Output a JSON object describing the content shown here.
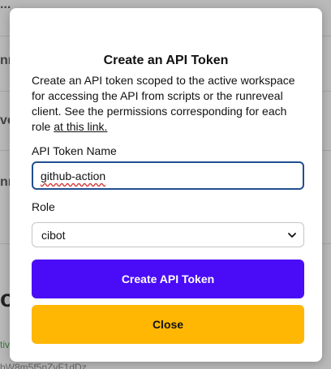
{
  "background": {
    "row_labels": [
      "nn",
      "ve",
      "nn"
    ],
    "top_fragment": "...",
    "big_fragment": "ok",
    "status_fragment": "tiv",
    "id_fragment": "bW8m5f5nZvF1dDz"
  },
  "modal": {
    "title": "Create an API Token",
    "description": "Create an API token scoped to the active workspace for accessing the API from scripts or the runreveal client. See the permissions corresponding for each role",
    "link_text": "at this link.",
    "name_label": "API Token Name",
    "name_value": "github-action",
    "role_label": "Role",
    "role_value": "cibot",
    "create_button": "Create API Token",
    "close_button": "Close"
  },
  "colors": {
    "primary": "#4a0cf7",
    "warning": "#ffb703",
    "input_border": "#1f4f91"
  }
}
